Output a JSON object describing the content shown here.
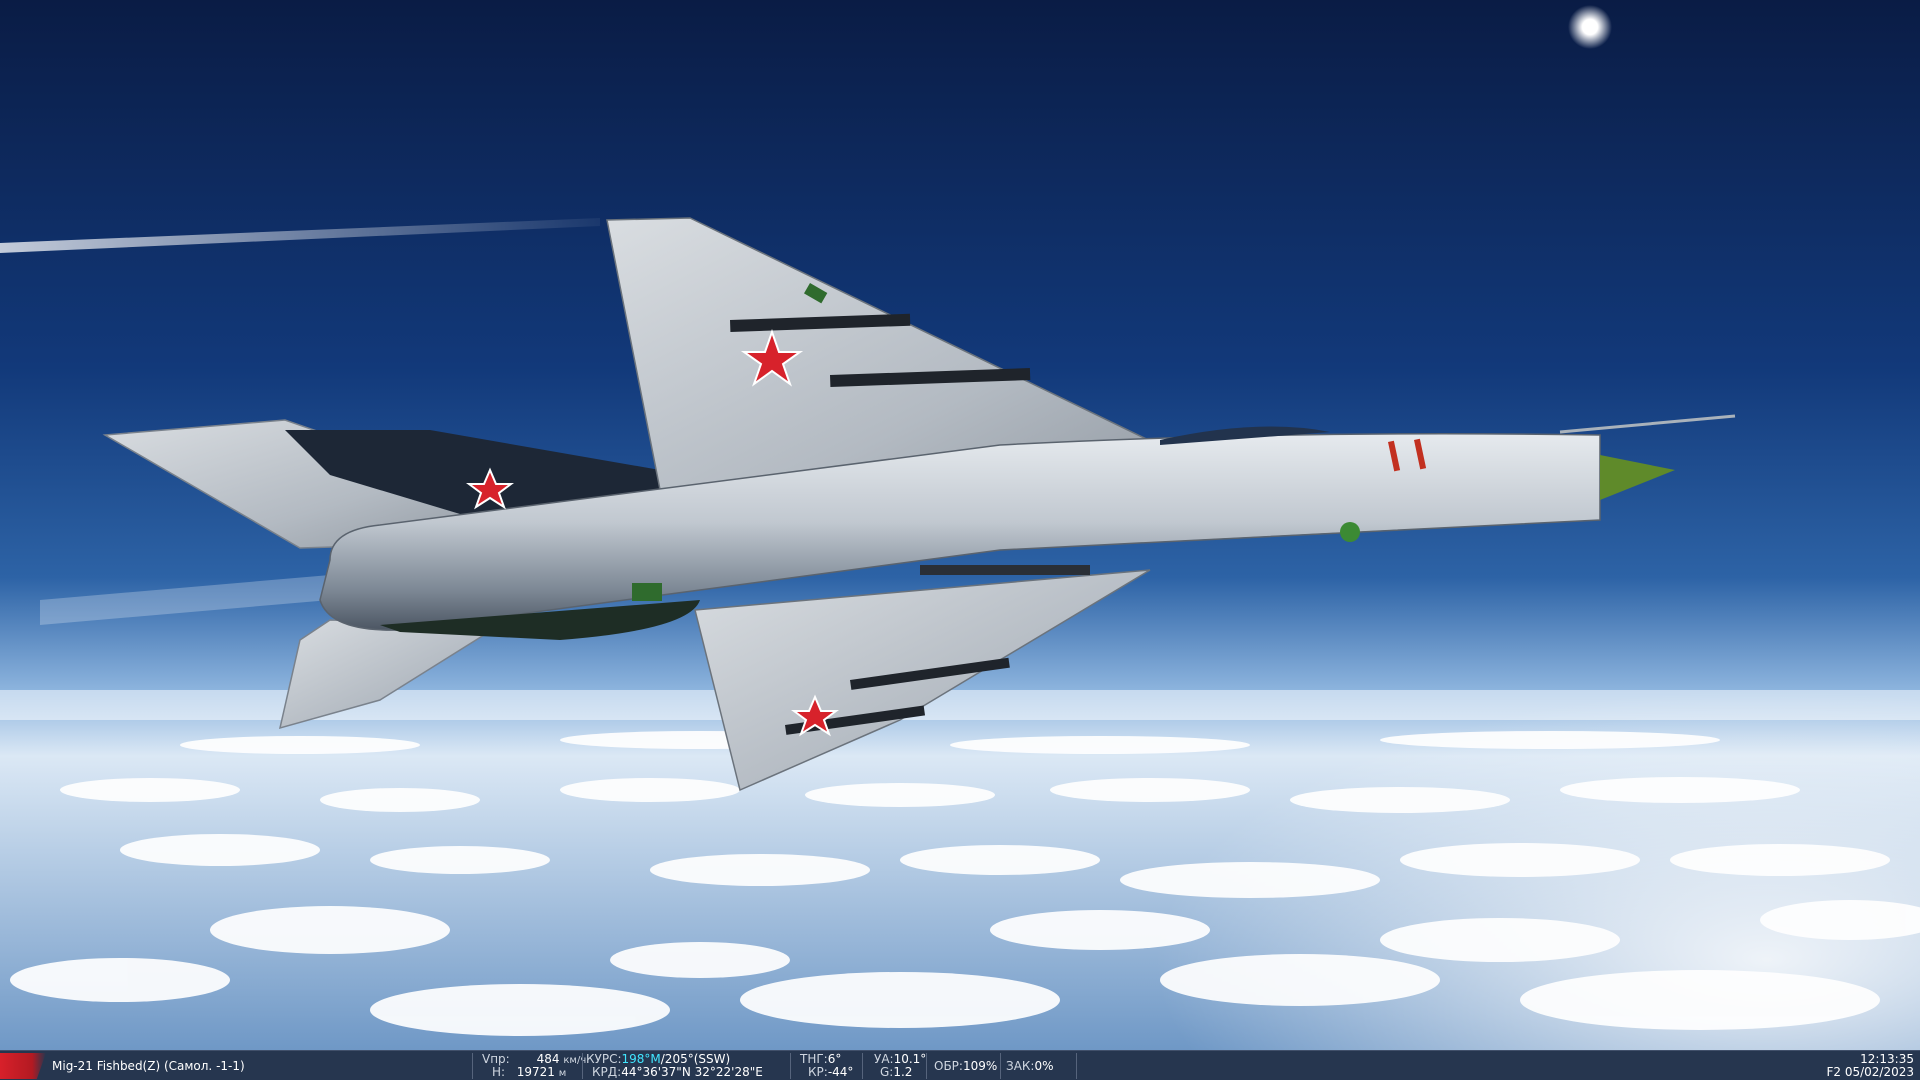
{
  "scene": {
    "description_icon": "mig21-aircraft-in-flight",
    "sky_top": "#0a1f4a",
    "sky_horizon": "#8fb6df",
    "cloud_color": "#ffffff"
  },
  "status": {
    "unit_name": "Mig-21 Fishbed(Z) (Самол. -1-1)",
    "speed_label": "Vпр:",
    "speed_value": "484",
    "speed_unit": "км/ч",
    "alt_label": "H:",
    "alt_value": "19721",
    "alt_unit": "м",
    "course_label": "КУРС:",
    "course_mag": "198°M",
    "course_true": "/205°(SSW)",
    "coord_label": "КРД:",
    "coord_value": "44°36'37\"N 32°22'28\"E",
    "pitch_label": "ТНГ:",
    "pitch_value": "6°",
    "roll_label": "КР:",
    "roll_value": "-44°",
    "aoa_label": "УА:",
    "aoa_value": "10.1°",
    "g_label": "G:",
    "g_value": "1.2",
    "rpm_label": "ОБР:",
    "rpm_value": "109%",
    "flaps_label": "ЗАК:",
    "flaps_value": "0%",
    "time": "12:13:35",
    "view_date": "F2 05/02/2023"
  }
}
